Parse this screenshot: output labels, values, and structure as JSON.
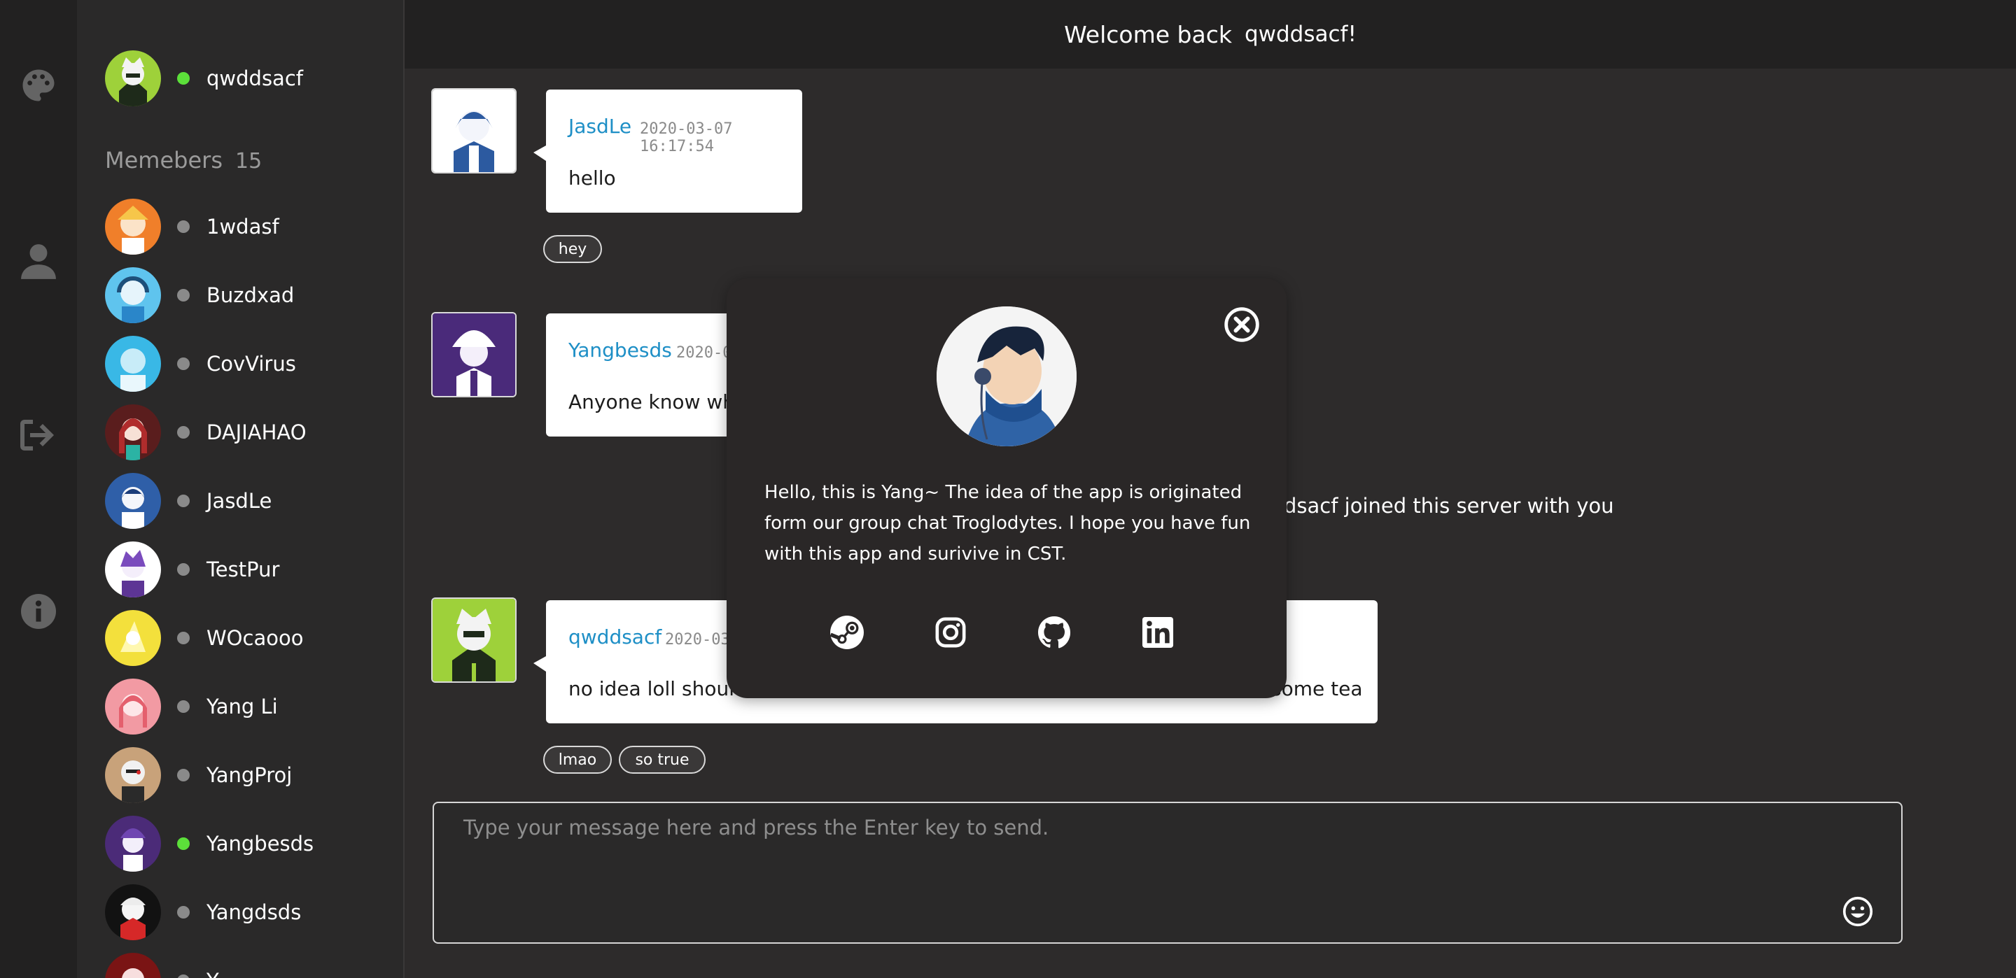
{
  "header": {
    "welcome": "Welcome back",
    "username": "qwddsacf!"
  },
  "current_user": {
    "name": "qwddsacf",
    "status": "online"
  },
  "members": {
    "title": "Memebers",
    "count": "15",
    "list": [
      {
        "name": "1wdasf",
        "status": "offline"
      },
      {
        "name": "Buzdxad",
        "status": "offline"
      },
      {
        "name": "CovVirus",
        "status": "offline"
      },
      {
        "name": "DAJIAHAO",
        "status": "offline"
      },
      {
        "name": "JasdLe",
        "status": "offline"
      },
      {
        "name": "TestPur",
        "status": "offline"
      },
      {
        "name": "WOcaooo",
        "status": "offline"
      },
      {
        "name": "Yang Li",
        "status": "offline"
      },
      {
        "name": "YangProj",
        "status": "offline"
      },
      {
        "name": "Yangbesds",
        "status": "online"
      },
      {
        "name": "Yangdsds",
        "status": "offline"
      },
      {
        "name": "Y...",
        "status": "offline"
      }
    ]
  },
  "messages": [
    {
      "author": "JasdLe",
      "time": "2020-03-07 16:17:54",
      "text": "hello",
      "reactions": [
        "hey"
      ]
    },
    {
      "author": "Yangbesds",
      "time": "2020-03",
      "text": "Anyone know wha",
      "reactions": []
    },
    {
      "author": "qwddsacf",
      "time": "2020-03-",
      "text": "no idea loll shouldn",
      "text_tail": "some tea",
      "reactions": [
        "lmao",
        "so true"
      ]
    }
  ],
  "system_message": "dsacf joined this server with you",
  "input": {
    "placeholder": "Type your message here and press the Enter key to send."
  },
  "modal": {
    "text": "Hello, this is Yang~ The idea of the app is originated form our group chat Troglodytes. I hope you have fun with this app and surivive in CST.",
    "social_icons": [
      "steam-icon",
      "instagram-icon",
      "github-icon",
      "linkedin-icon"
    ]
  },
  "colors": {
    "background": "#2d2b2b",
    "sidebar": "#2a2929",
    "rail": "#222121",
    "link": "#1e8fc6",
    "online": "#5ce03a",
    "offline": "#8a8a8a"
  }
}
